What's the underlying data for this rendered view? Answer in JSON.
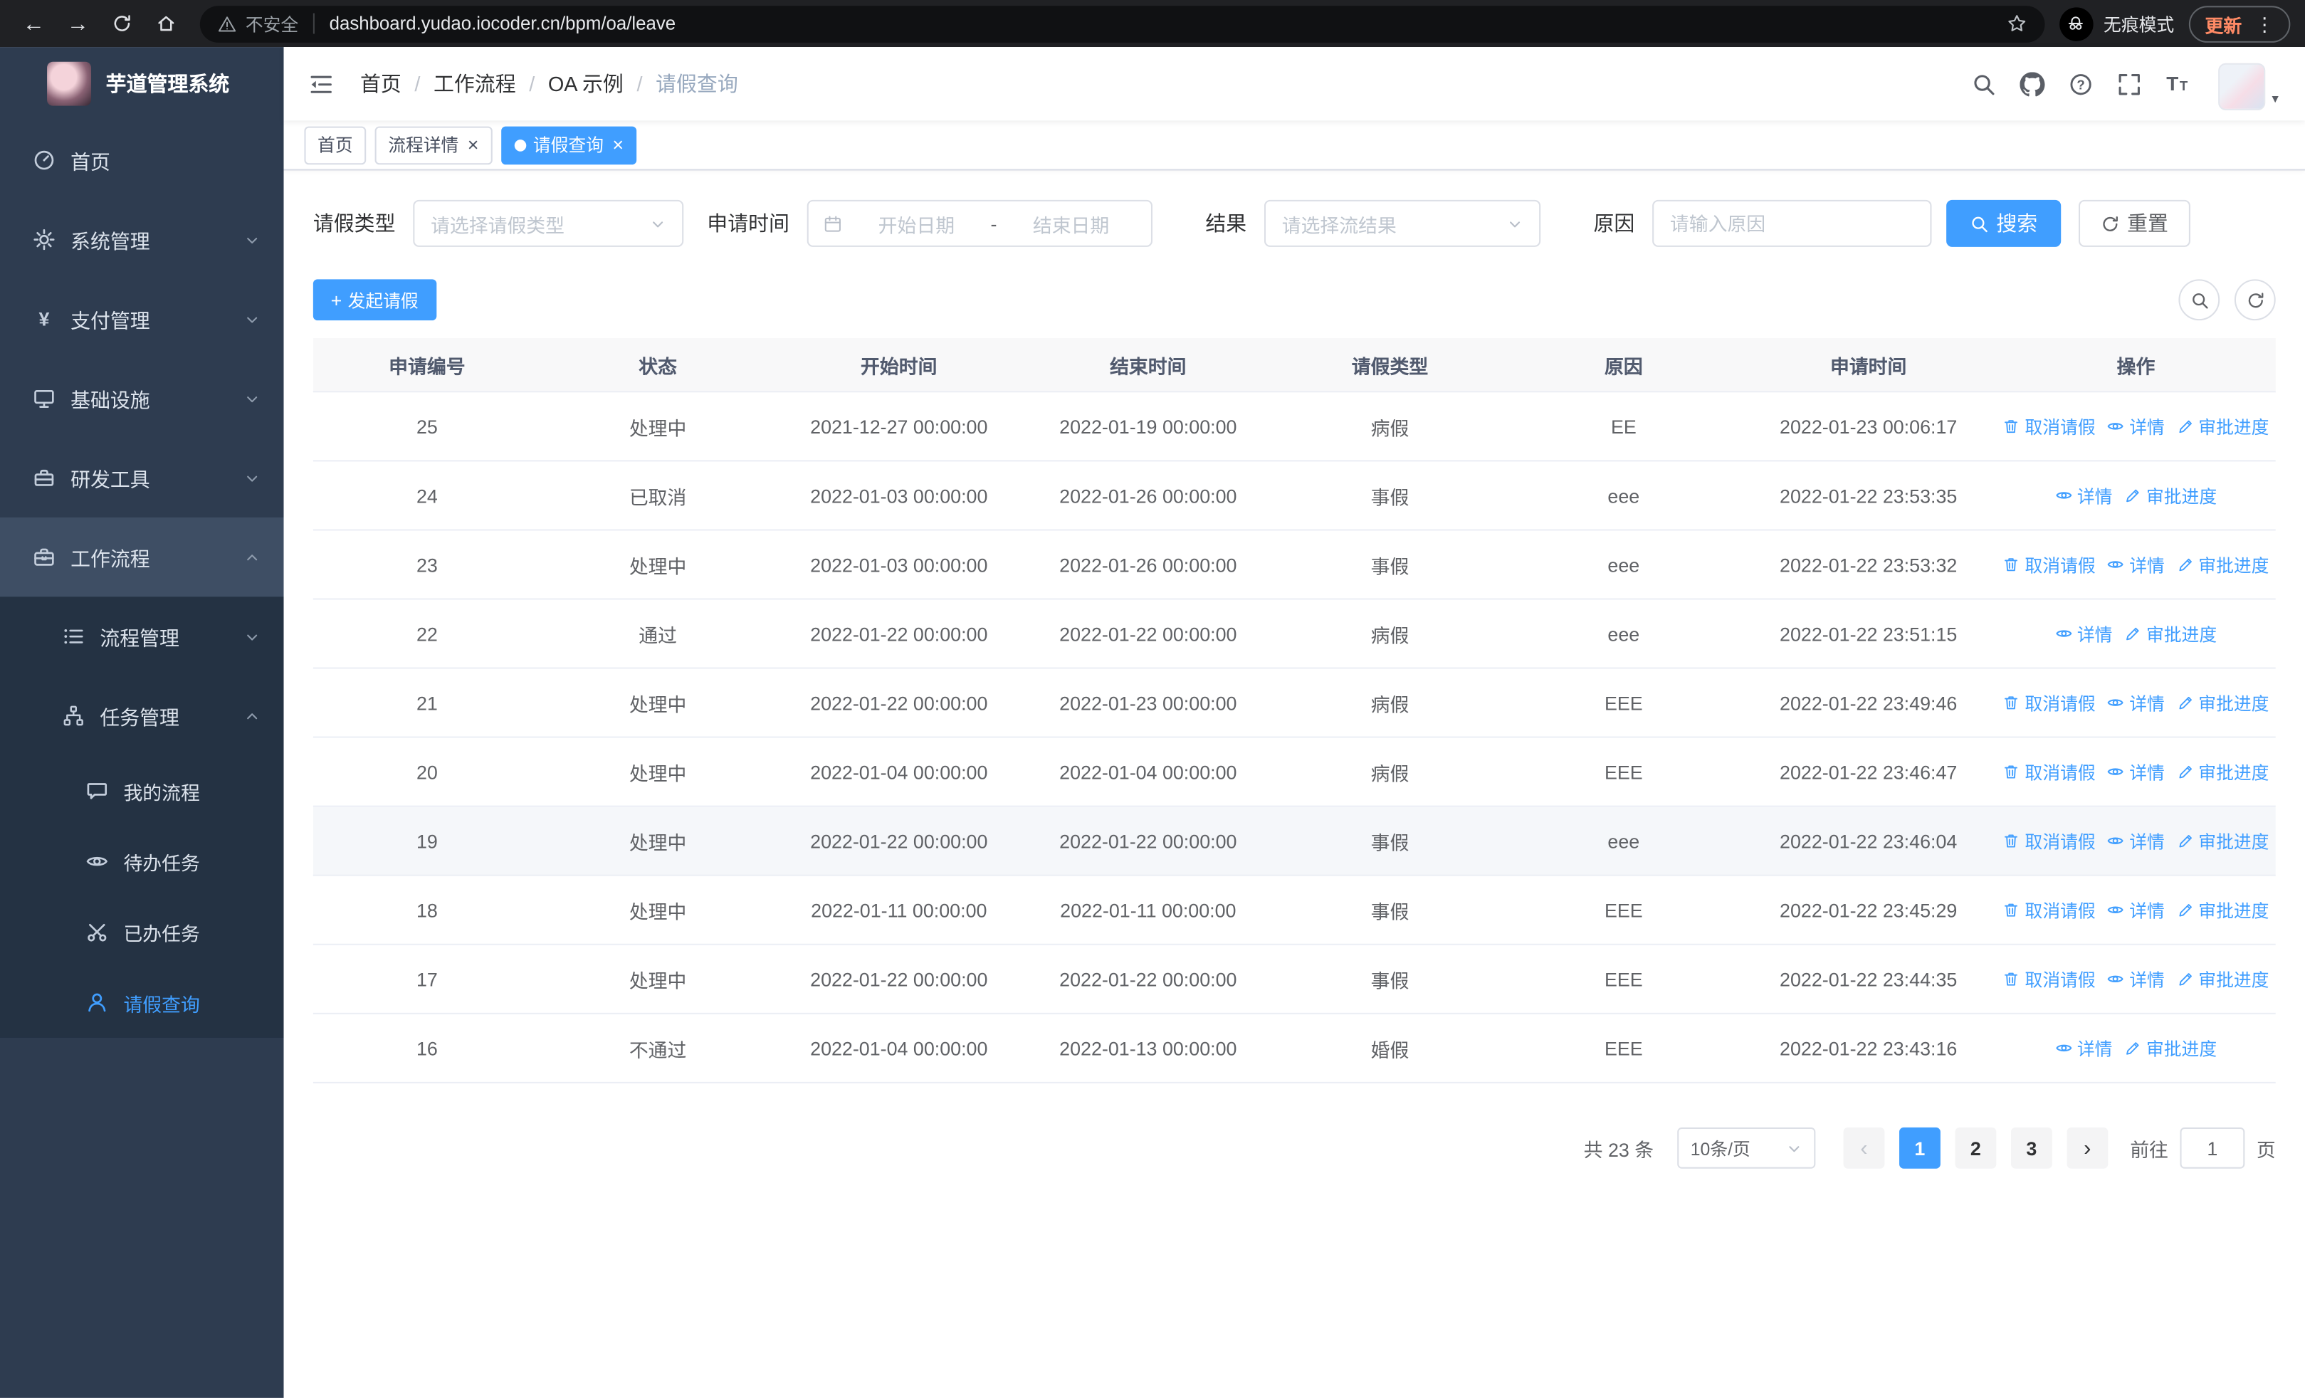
{
  "colors": {
    "primary": "#409eff",
    "browser_bar": "#202124",
    "sidebar_bg": "#2e3c50",
    "sidebar_submenu_bg": "#243243",
    "table_header_bg": "#f8f8f9",
    "row_hover_bg": "#f5f7fa",
    "update_text": "#ff8a65"
  },
  "glyphs": {
    "back": "←",
    "forward": "→",
    "kebab": "⋮",
    "close": "×",
    "plus": "+",
    "prev": "‹",
    "next": "›",
    "caret": "▾",
    "slash": "/",
    "star": "☆"
  },
  "browser": {
    "security_warning": "不安全",
    "url": "dashboard.yudao.iocoder.cn/bpm/oa/leave",
    "incognito_label": "无痕模式",
    "update_label": "更新"
  },
  "sidebar": {
    "app_title": "芋道管理系统",
    "items": [
      {
        "label": "首页"
      },
      {
        "label": "系统管理"
      },
      {
        "label": "支付管理"
      },
      {
        "label": "基础设施"
      },
      {
        "label": "研发工具"
      },
      {
        "label": "工作流程"
      },
      {
        "label": "流程管理"
      },
      {
        "label": "任务管理"
      },
      {
        "label": "我的流程"
      },
      {
        "label": "待办任务"
      },
      {
        "label": "已办任务"
      },
      {
        "label": "请假查询"
      }
    ]
  },
  "breadcrumb": {
    "items": [
      "首页",
      "工作流程",
      "OA 示例",
      "请假查询"
    ]
  },
  "tabs": [
    {
      "label": "首页"
    },
    {
      "label": "流程详情"
    },
    {
      "label": "请假查询"
    }
  ],
  "filters": {
    "leave_type_label": "请假类型",
    "leave_type_placeholder": "请选择请假类型",
    "apply_time_label": "申请时间",
    "start_date_placeholder": "开始日期",
    "range_separator": "-",
    "end_date_placeholder": "结束日期",
    "result_label": "结果",
    "result_placeholder": "请选择流结果",
    "reason_label": "原因",
    "reason_placeholder": "请输入原因",
    "search_button": "搜索",
    "reset_button": "重置"
  },
  "toolbar": {
    "create_button": "发起请假"
  },
  "table": {
    "columns": [
      "申请编号",
      "状态",
      "开始时间",
      "结束时间",
      "请假类型",
      "原因",
      "申请时间",
      "操作"
    ],
    "actions": {
      "cancel": "取消请假",
      "detail": "详情",
      "progress": "审批进度"
    },
    "rows": [
      {
        "id": "25",
        "status": "处理中",
        "start": "2021-12-27 00:00:00",
        "end": "2022-01-19 00:00:00",
        "type": "病假",
        "reason": "EE",
        "applied": "2022-01-23 00:06:17",
        "cancellable": true,
        "hovered": false
      },
      {
        "id": "24",
        "status": "已取消",
        "start": "2022-01-03 00:00:00",
        "end": "2022-01-26 00:00:00",
        "type": "事假",
        "reason": "eee",
        "applied": "2022-01-22 23:53:35",
        "cancellable": false,
        "hovered": false
      },
      {
        "id": "23",
        "status": "处理中",
        "start": "2022-01-03 00:00:00",
        "end": "2022-01-26 00:00:00",
        "type": "事假",
        "reason": "eee",
        "applied": "2022-01-22 23:53:32",
        "cancellable": true,
        "hovered": false
      },
      {
        "id": "22",
        "status": "通过",
        "start": "2022-01-22 00:00:00",
        "end": "2022-01-22 00:00:00",
        "type": "病假",
        "reason": "eee",
        "applied": "2022-01-22 23:51:15",
        "cancellable": false,
        "hovered": false
      },
      {
        "id": "21",
        "status": "处理中",
        "start": "2022-01-22 00:00:00",
        "end": "2022-01-23 00:00:00",
        "type": "病假",
        "reason": "EEE",
        "applied": "2022-01-22 23:49:46",
        "cancellable": true,
        "hovered": false
      },
      {
        "id": "20",
        "status": "处理中",
        "start": "2022-01-04 00:00:00",
        "end": "2022-01-04 00:00:00",
        "type": "病假",
        "reason": "EEE",
        "applied": "2022-01-22 23:46:47",
        "cancellable": true,
        "hovered": false
      },
      {
        "id": "19",
        "status": "处理中",
        "start": "2022-01-22 00:00:00",
        "end": "2022-01-22 00:00:00",
        "type": "事假",
        "reason": "eee",
        "applied": "2022-01-22 23:46:04",
        "cancellable": true,
        "hovered": true
      },
      {
        "id": "18",
        "status": "处理中",
        "start": "2022-01-11 00:00:00",
        "end": "2022-01-11 00:00:00",
        "type": "事假",
        "reason": "EEE",
        "applied": "2022-01-22 23:45:29",
        "cancellable": true,
        "hovered": false
      },
      {
        "id": "17",
        "status": "处理中",
        "start": "2022-01-22 00:00:00",
        "end": "2022-01-22 00:00:00",
        "type": "事假",
        "reason": "EEE",
        "applied": "2022-01-22 23:44:35",
        "cancellable": true,
        "hovered": false
      },
      {
        "id": "16",
        "status": "不通过",
        "start": "2022-01-04 00:00:00",
        "end": "2022-01-13 00:00:00",
        "type": "婚假",
        "reason": "EEE",
        "applied": "2022-01-22 23:43:16",
        "cancellable": false,
        "hovered": false
      }
    ]
  },
  "pagination": {
    "total_text": "共 23 条",
    "page_size": "10条/页",
    "pages": [
      "1",
      "2",
      "3"
    ],
    "current_page": "1",
    "goto_label": "前往",
    "goto_value": "1",
    "page_suffix": "页"
  }
}
